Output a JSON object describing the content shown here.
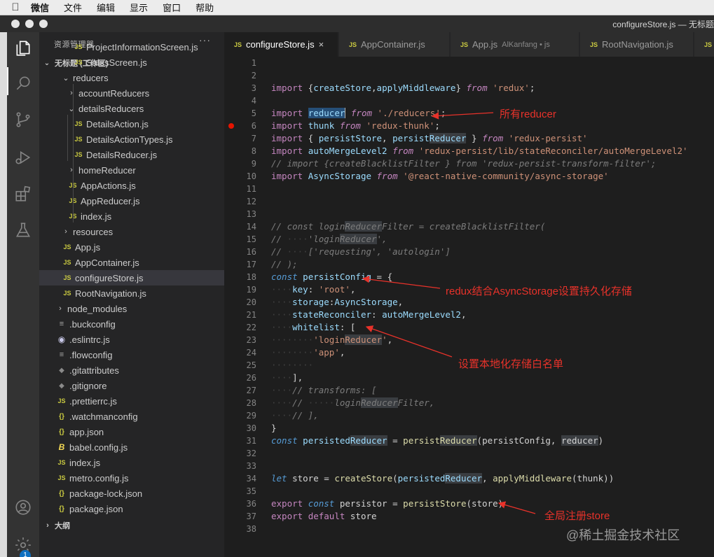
{
  "menubar": {
    "app": "微信",
    "items": [
      "文件",
      "编辑",
      "显示",
      "窗口",
      "帮助"
    ]
  },
  "window": {
    "title": "configureStore.js — 无标题"
  },
  "activity_badge": "1",
  "sidebar": {
    "title": "资源管理器",
    "more": "···",
    "workspace": "无标题 (工作区)",
    "items": [
      {
        "label": "ProjectInformationScreen.js",
        "icon": "js"
      },
      {
        "label": "SalesScreen.js",
        "icon": "js"
      },
      {
        "label": "reducers",
        "icon": "folder-open"
      },
      {
        "label": "accountReducers",
        "icon": "folder-closed"
      },
      {
        "label": "detailsReducers",
        "icon": "folder-open"
      },
      {
        "label": "DetailsAction.js",
        "icon": "js"
      },
      {
        "label": "DetailsActionTypes.js",
        "icon": "js"
      },
      {
        "label": "DetailsReducer.js",
        "icon": "js"
      },
      {
        "label": "homeReducer",
        "icon": "folder-closed"
      },
      {
        "label": "AppActions.js",
        "icon": "js"
      },
      {
        "label": "AppReducer.js",
        "icon": "js"
      },
      {
        "label": "index.js",
        "icon": "js"
      },
      {
        "label": "resources",
        "icon": "folder-closed"
      },
      {
        "label": "App.js",
        "icon": "js"
      },
      {
        "label": "AppContainer.js",
        "icon": "js"
      },
      {
        "label": "configureStore.js",
        "icon": "js"
      },
      {
        "label": "RootNavigation.js",
        "icon": "js"
      },
      {
        "label": "node_modules",
        "icon": "folder-closed"
      },
      {
        "label": ".buckconfig",
        "icon": "lines"
      },
      {
        "label": ".eslintrc.js",
        "icon": "circle"
      },
      {
        "label": ".flowconfig",
        "icon": "lines"
      },
      {
        "label": ".gitattributes",
        "icon": "git"
      },
      {
        "label": ".gitignore",
        "icon": "git"
      },
      {
        "label": ".prettierrc.js",
        "icon": "js"
      },
      {
        "label": ".watchmanconfig",
        "icon": "json"
      },
      {
        "label": "app.json",
        "icon": "json"
      },
      {
        "label": "babel.config.js",
        "icon": "babel"
      },
      {
        "label": "index.js",
        "icon": "js"
      },
      {
        "label": "metro.config.js",
        "icon": "js"
      },
      {
        "label": "package-lock.json",
        "icon": "json"
      },
      {
        "label": "package.json",
        "icon": "json"
      }
    ],
    "selected_index": 15,
    "outline_label": "大纲"
  },
  "tabs": [
    {
      "label": "configureStore.js",
      "active": true,
      "close": "×"
    },
    {
      "label": "AppContainer.js"
    },
    {
      "label": "App.js",
      "description": "AlKanfang • js"
    },
    {
      "label": "RootNavigation.js"
    },
    {
      "label": ""
    }
  ],
  "icon_label": "JS",
  "editor": {
    "breakpoint_line": 6,
    "lines": [
      [],
      [],
      [
        [
          "imp",
          "import"
        ],
        [
          "p",
          " {"
        ],
        [
          "var",
          "createStore"
        ],
        [
          "p",
          ","
        ],
        [
          "var",
          "applyMiddleware"
        ],
        [
          "p",
          "} "
        ],
        [
          "fr",
          "from"
        ],
        [
          "p",
          " "
        ],
        [
          "str",
          "'redux'"
        ],
        [
          "p",
          ";"
        ]
      ],
      [],
      [
        [
          "imp",
          "import"
        ],
        [
          "p",
          " "
        ],
        [
          "hl2var",
          "reducer"
        ],
        [
          "p",
          " "
        ],
        [
          "fr",
          "from"
        ],
        [
          "p",
          " "
        ],
        [
          "str",
          "'./reducers'"
        ],
        [
          "p",
          ";"
        ]
      ],
      [
        [
          "imp",
          "import"
        ],
        [
          "p",
          " "
        ],
        [
          "var",
          "thunk"
        ],
        [
          "p",
          " "
        ],
        [
          "fr",
          "from"
        ],
        [
          "p",
          " "
        ],
        [
          "str",
          "'redux-thunk'"
        ],
        [
          "p",
          ";"
        ]
      ],
      [
        [
          "imp",
          "import"
        ],
        [
          "p",
          " { "
        ],
        [
          "var",
          "persistStore"
        ],
        [
          "p",
          ", "
        ],
        [
          "var",
          "persist"
        ],
        [
          "hlvar",
          "Reducer"
        ],
        [
          "p",
          " } "
        ],
        [
          "fr",
          "from"
        ],
        [
          "p",
          " "
        ],
        [
          "str",
          "'redux-persist'"
        ]
      ],
      [
        [
          "imp",
          "import"
        ],
        [
          "p",
          " "
        ],
        [
          "var",
          "autoMergeLevel2"
        ],
        [
          "p",
          " "
        ],
        [
          "fr",
          "from"
        ],
        [
          "p",
          " "
        ],
        [
          "str",
          "'redux-persist/lib/stateReconciler/autoMergeLevel2'"
        ]
      ],
      [
        [
          "cm",
          "// import {createBlacklistFilter } from 'redux-persist-transform-filter';"
        ]
      ],
      [
        [
          "imp",
          "import"
        ],
        [
          "p",
          " "
        ],
        [
          "var",
          "AsyncStorage"
        ],
        [
          "p",
          " "
        ],
        [
          "fr",
          "from"
        ],
        [
          "p",
          " "
        ],
        [
          "str",
          "'@react-native-community/async-storage'"
        ]
      ],
      [],
      [],
      [],
      [
        [
          "cm",
          "// const login"
        ],
        [
          "cmhl",
          "Reducer"
        ],
        [
          "cm",
          "Filter = createBlacklistFilter("
        ]
      ],
      [
        [
          "cm",
          "// "
        ],
        [
          "dot",
          "····"
        ],
        [
          "cm",
          "'login"
        ],
        [
          "cmhl",
          "Reducer"
        ],
        [
          "cm",
          "',"
        ]
      ],
      [
        [
          "cm",
          "// "
        ],
        [
          "dot",
          "····"
        ],
        [
          "cm",
          "['requesting', 'autologin']"
        ]
      ],
      [
        [
          "cm",
          "// );"
        ]
      ],
      [
        [
          "kwi",
          "const"
        ],
        [
          "p",
          " "
        ],
        [
          "var",
          "persistConfig"
        ],
        [
          "p",
          " = {"
        ]
      ],
      [
        [
          "dot",
          "····"
        ],
        [
          "var",
          "key"
        ],
        [
          "p",
          ": "
        ],
        [
          "str",
          "'root'"
        ],
        [
          "p",
          ","
        ]
      ],
      [
        [
          "dot",
          "····"
        ],
        [
          "var",
          "storage"
        ],
        [
          "p",
          ":"
        ],
        [
          "var",
          "AsyncStorage"
        ],
        [
          "p",
          ","
        ]
      ],
      [
        [
          "dot",
          "····"
        ],
        [
          "var",
          "stateReconciler"
        ],
        [
          "p",
          ": "
        ],
        [
          "var",
          "autoMergeLevel2"
        ],
        [
          "p",
          ","
        ]
      ],
      [
        [
          "dot",
          "····"
        ],
        [
          "var",
          "whitelist"
        ],
        [
          "p",
          ": ["
        ]
      ],
      [
        [
          "dot",
          "········"
        ],
        [
          "str",
          "'login"
        ],
        [
          "strhl",
          "Reducer"
        ],
        [
          "str",
          "'"
        ],
        [
          "p",
          ","
        ]
      ],
      [
        [
          "dot",
          "········"
        ],
        [
          "str",
          "'app'"
        ],
        [
          "p",
          ","
        ]
      ],
      [
        [
          "dot",
          "········"
        ]
      ],
      [
        [
          "dot",
          "····"
        ],
        [
          "p",
          "],"
        ]
      ],
      [
        [
          "dot",
          "····"
        ],
        [
          "cm",
          "// transforms: ["
        ]
      ],
      [
        [
          "dot",
          "····"
        ],
        [
          "cm",
          "// "
        ],
        [
          "dot",
          "·····"
        ],
        [
          "cm",
          "login"
        ],
        [
          "cmhl",
          "Reducer"
        ],
        [
          "cm",
          "Filter,"
        ]
      ],
      [
        [
          "dot",
          "····"
        ],
        [
          "cm",
          "// ],"
        ]
      ],
      [
        [
          "p",
          "}"
        ]
      ],
      [
        [
          "kwi",
          "const"
        ],
        [
          "p",
          " "
        ],
        [
          "var",
          "persisted"
        ],
        [
          "hlvar",
          "Reducer"
        ],
        [
          "p",
          " = "
        ],
        [
          "fn",
          "persist"
        ],
        [
          "hlfn",
          "Reducer"
        ],
        [
          "p",
          "(persistConfig, "
        ],
        [
          "hlp",
          "reducer"
        ],
        [
          "p",
          ")"
        ]
      ],
      [],
      [],
      [
        [
          "kwi",
          "let"
        ],
        [
          "p",
          " store = "
        ],
        [
          "fn",
          "createStore"
        ],
        [
          "p",
          "("
        ],
        [
          "var",
          "persisted"
        ],
        [
          "hlvar",
          "Reducer"
        ],
        [
          "p",
          ", "
        ],
        [
          "fn",
          "applyMiddleware"
        ],
        [
          "p",
          "(thunk))"
        ]
      ],
      [],
      [
        [
          "imp",
          "export"
        ],
        [
          "p",
          " "
        ],
        [
          "kwi",
          "const"
        ],
        [
          "p",
          " persistor = "
        ],
        [
          "fn",
          "persistStore"
        ],
        [
          "p",
          "(store)"
        ]
      ],
      [
        [
          "imp",
          "export"
        ],
        [
          "p",
          " "
        ],
        [
          "imp",
          "default"
        ],
        [
          "p",
          " store"
        ]
      ],
      []
    ]
  },
  "annotations": {
    "reducer": "所有reducer",
    "persist": "redux结合AsyncStorage设置持久化存储",
    "whitelist": "设置本地化存储白名单",
    "store": "全局注册store",
    "color": "#e8322a"
  },
  "watermark": "@稀土掘金技术社区"
}
